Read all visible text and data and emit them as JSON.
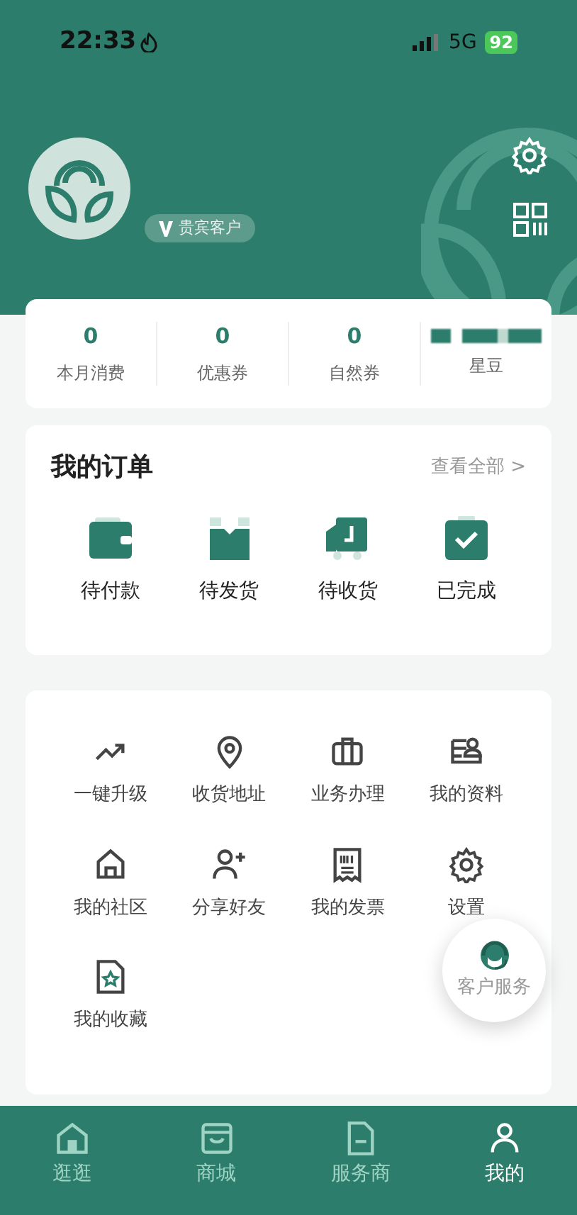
{
  "status_bar": {
    "time": "22:33",
    "network": "5G",
    "battery": "92"
  },
  "profile": {
    "badge": "贵宾客户"
  },
  "stats": [
    {
      "value": "0",
      "label": "本月消费"
    },
    {
      "value": "0",
      "label": "优惠券"
    },
    {
      "value": "0",
      "label": "自然券"
    },
    {
      "label": "星豆",
      "redacted": true
    }
  ],
  "orders": {
    "title": "我的订单",
    "more": "查看全部 >",
    "items": [
      {
        "label": "待付款",
        "kind": "wallet"
      },
      {
        "label": "待发货",
        "kind": "box"
      },
      {
        "label": "待收货",
        "kind": "truck"
      },
      {
        "label": "已完成",
        "kind": "done"
      }
    ]
  },
  "services": [
    {
      "label": "一键升级",
      "kind": "trend"
    },
    {
      "label": "收货地址",
      "kind": "pin"
    },
    {
      "label": "业务办理",
      "kind": "case"
    },
    {
      "label": "我的资料",
      "kind": "card"
    },
    {
      "label": "我的社区",
      "kind": "home"
    },
    {
      "label": "分享好友",
      "kind": "adduser"
    },
    {
      "label": "我的发票",
      "kind": "invoice"
    },
    {
      "label": "设置",
      "kind": "gear"
    },
    {
      "label": "我的收藏",
      "kind": "fav"
    }
  ],
  "support_button": {
    "label": "客户服务"
  },
  "tab_bar": [
    {
      "label": "逛逛",
      "kind": "home",
      "selected": false
    },
    {
      "label": "商城",
      "kind": "bag",
      "selected": false
    },
    {
      "label": "服务商",
      "kind": "doc",
      "selected": false
    },
    {
      "label": "我的",
      "kind": "user",
      "selected": true
    }
  ]
}
